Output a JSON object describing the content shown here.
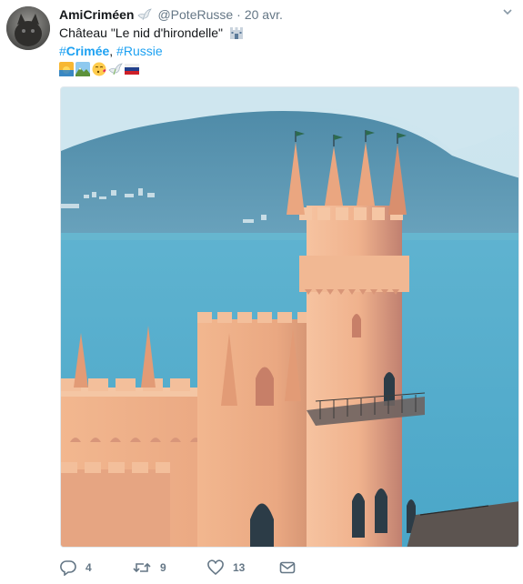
{
  "tweet": {
    "display_name": "AmiCriméen",
    "handle": "@PoteRusse",
    "separator": "·",
    "date": "20 avr.",
    "text_main": "Château \"Le nid d'hirondelle\"",
    "hashtag_crimee_prefix": "#",
    "hashtag_crimee": "Crimée",
    "hashtag_sep": ", ",
    "hashtag_russie": "#Russie",
    "emojis": [
      "sunrise-emoji",
      "landscape-emoji",
      "blowing-kiss-emoji",
      "dove-emoji",
      "russian-flag-emoji"
    ]
  },
  "actions": {
    "reply_count": "4",
    "retweet_count": "9",
    "like_count": "13"
  },
  "colors": {
    "link": "#1da1f2",
    "muted": "#657786",
    "text": "#14171a"
  }
}
